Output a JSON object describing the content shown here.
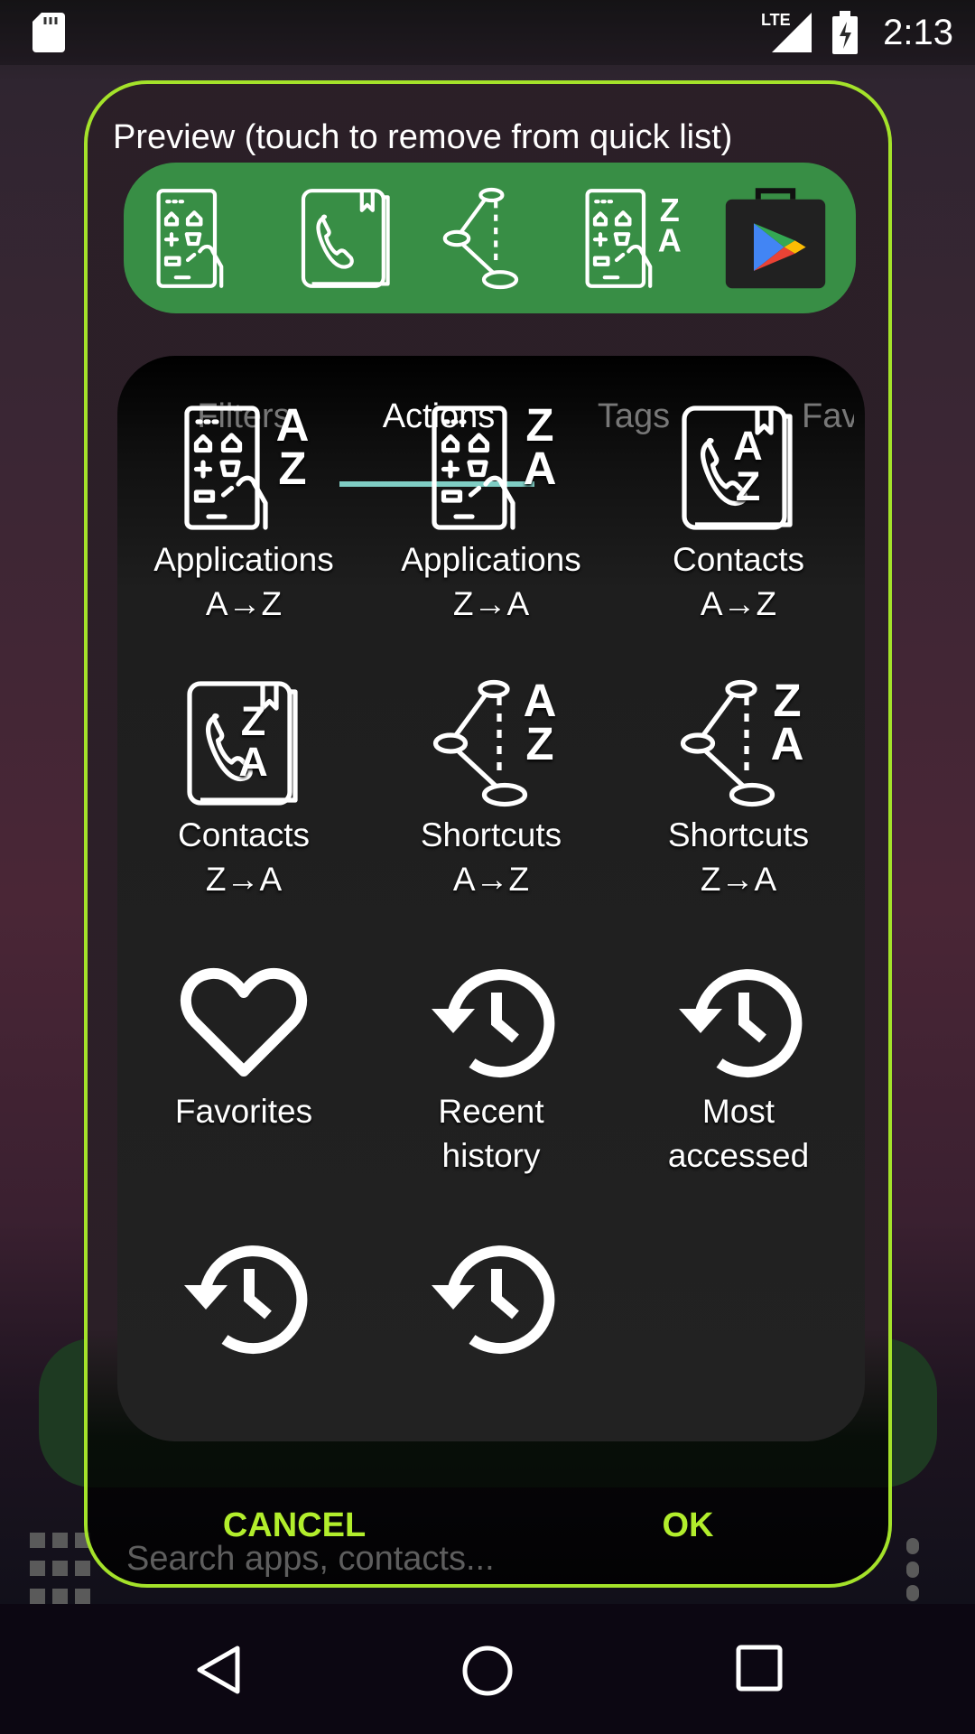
{
  "status_bar": {
    "time": "2:13",
    "network": "LTE",
    "icons": [
      "sd-card-icon",
      "signal-icon",
      "battery-charging-icon"
    ]
  },
  "background": {
    "search_placeholder": "Search apps, contacts..."
  },
  "dialog": {
    "title": "Preview (touch to remove from quick list)",
    "preview_items": [
      {
        "icon": "apps-icon"
      },
      {
        "icon": "contacts-icon"
      },
      {
        "icon": "shortcuts-icon"
      },
      {
        "icon": "apps-za-icon"
      },
      {
        "icon": "play-store-icon"
      }
    ],
    "tabs": [
      {
        "label": "Filters"
      },
      {
        "label": "Actions",
        "active": true
      },
      {
        "label": "Tags"
      },
      {
        "label": "Favo"
      }
    ],
    "actions": [
      {
        "icon": "apps",
        "letters": [
          "A",
          "Z"
        ],
        "label1": "Applications",
        "label2": "A→Z"
      },
      {
        "icon": "apps",
        "letters": [
          "Z",
          "A"
        ],
        "label1": "Applications",
        "label2": "Z→A"
      },
      {
        "icon": "contacts",
        "letters": [
          "A",
          "Z"
        ],
        "label1": "Contacts",
        "label2": "A→Z"
      },
      {
        "icon": "contacts",
        "letters": [
          "Z",
          "A"
        ],
        "label1": "Contacts",
        "label2": "Z→A"
      },
      {
        "icon": "shortcuts",
        "letters": [
          "A",
          "Z"
        ],
        "label1": "Shortcuts",
        "label2": "A→Z"
      },
      {
        "icon": "shortcuts",
        "letters": [
          "Z",
          "A"
        ],
        "label1": "Shortcuts",
        "label2": "Z→A"
      },
      {
        "icon": "heart",
        "letters": [],
        "label1": "Favorites",
        "label2": ""
      },
      {
        "icon": "history",
        "letters": [],
        "label1": "Recent",
        "label2": "history"
      },
      {
        "icon": "history",
        "letters": [],
        "label1": "Most",
        "label2": "accessed"
      },
      {
        "icon": "history",
        "letters": [],
        "label1": "",
        "label2": ""
      },
      {
        "icon": "history",
        "letters": [],
        "label1": "",
        "label2": ""
      }
    ],
    "cancel_label": "CANCEL",
    "ok_label": "OK"
  },
  "colors": {
    "accent": "#a4e22a",
    "button_text": "#b2ee2c",
    "preview_bg": "#388e45",
    "tab_indicator": "#7fcdc4"
  }
}
